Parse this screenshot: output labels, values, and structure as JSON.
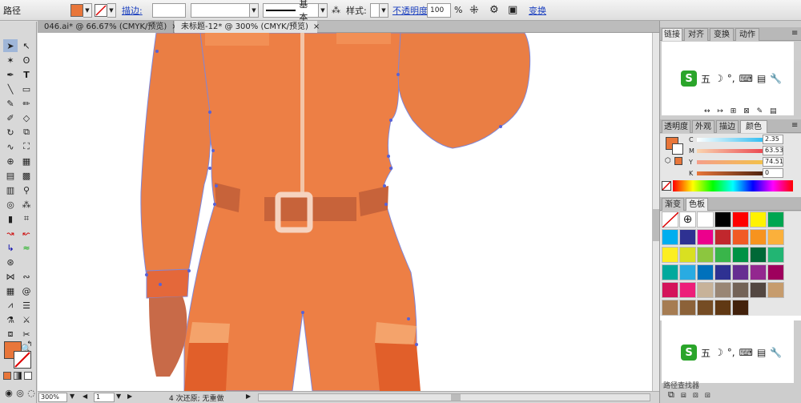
{
  "control_bar": {
    "object_type": "路径",
    "fill_color": "#e8763a",
    "stroke_label": "描边:",
    "stroke_weight_value": "",
    "brush_style_value": "",
    "brush_definition": "基本",
    "style_label": "样式:",
    "opacity_label": "不透明度",
    "opacity_value": "100",
    "opacity_unit": "%",
    "transform_label": "变换"
  },
  "tabs": [
    {
      "label": "046.ai* @ 66.67% (CMYK/预览)",
      "active": false
    },
    {
      "label": "未标题-12* @ 300% (CMYK/预览)",
      "active": true
    }
  ],
  "status": {
    "zoom": "300%",
    "artboard": "1",
    "message": "4 次还原; 无重做"
  },
  "panels": {
    "top_tabs": [
      "链接",
      "对齐",
      "变换",
      "动作"
    ],
    "color_tabs": [
      "透明度",
      "外观",
      "描边",
      "颜色"
    ],
    "color_sliders": [
      {
        "label": "C",
        "value": "2.35"
      },
      {
        "label": "M",
        "value": "63.53"
      },
      {
        "label": "Y",
        "value": "74.51"
      },
      {
        "label": "K",
        "value": "0"
      }
    ],
    "swatch_tabs": [
      "渐变",
      "色板"
    ],
    "swatches": [
      "#ffffff",
      "#000000",
      "#ff0000",
      "#fff200",
      "#00a651",
      "#00aeef",
      "#2e3192",
      "#ec008c",
      "#c1272d",
      "#f15a24",
      "#f7931e",
      "#fbb03b",
      "#fcee21",
      "#d9e021",
      "#8cc63f",
      "#39b54a",
      "#009245",
      "#006837",
      "#22b573",
      "#00a99d",
      "#29abe2",
      "#0071bc",
      "#2e3192",
      "#662d91",
      "#93278f",
      "#9e005d",
      "#d4145a",
      "#ed1e79",
      "#c7b299",
      "#998675",
      "#736357",
      "#534741",
      "#c69c6d",
      "#a67c52",
      "#8c6239",
      "#754c24",
      "#603813",
      "#42210b"
    ],
    "ime_label": "五",
    "bottom_label": "路径查找器"
  }
}
